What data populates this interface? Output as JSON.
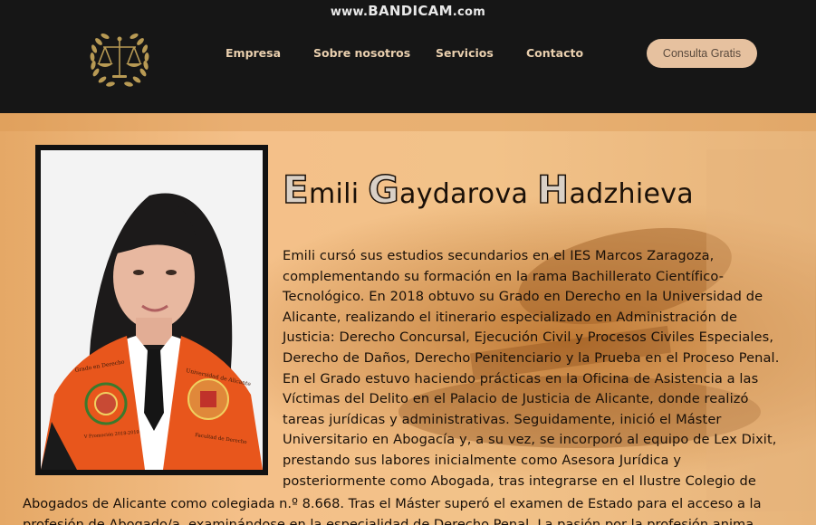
{
  "watermark": {
    "prefix": "www.",
    "brand": "BANDICAM",
    "suffix": ".com"
  },
  "nav": {
    "items": [
      {
        "label": "Empresa"
      },
      {
        "label": "Sobre nosotros"
      },
      {
        "label": "Servicios"
      },
      {
        "label": "Contacto"
      }
    ],
    "cta_label": "Consulta Gratis"
  },
  "profile": {
    "name_parts": [
      {
        "cap": "E",
        "rest": "mili "
      },
      {
        "cap": "G",
        "rest": "aydarova "
      },
      {
        "cap": "H",
        "rest": "adzhieva"
      }
    ],
    "bio_lines": [
      "Emili cursó sus estudios secundarios en el IES Marcos Zaragoza,",
      "complementando su formación en la rama Bachillerato Científico-",
      "Tecnológico. En 2018 obtuvo su Grado en Derecho en la Universidad de",
      "Alicante, realizando el itinerario especializado en Administración de",
      "Justicia: Derecho Concursal, Ejecución Civil y Procesos Civiles Especiales,",
      "Derecho de Daños, Derecho Penitenciario y la Prueba en el Proceso Penal.",
      "En el Grado estuvo haciendo prácticas en la Oficina de Asistencia a las",
      "Víctimas del Delito en el Palacio de Justicia de Alicante, donde realizó",
      "tareas jurídicas y administrativas. Seguidamente, inició el Máster",
      "Universitario en Abogacía y, a su vez, se incorporó al equipo de Lex Dixit,",
      "prestando sus labores inicialmente como Asesora Jurídica y",
      "posteriormente como Abogada, tras integrarse en el Ilustre Colegio de"
    ],
    "bio_cont_lines": [
      "Abogados de Alicante como colegiada n.º 8.668. Tras el Máster superó el examen de Estado para el acceso a la",
      "profesión de Abogado/a, examinándose en la especialidad de Derecho Penal. La pasión por la profesión anima"
    ],
    "stole_left_text": "Grado en Derecho",
    "stole_left_sub": "V Promoción 2018-2019",
    "stole_right_text": "Universidad de Alicante",
    "stole_right_sub": "Facultad de Derecho"
  }
}
